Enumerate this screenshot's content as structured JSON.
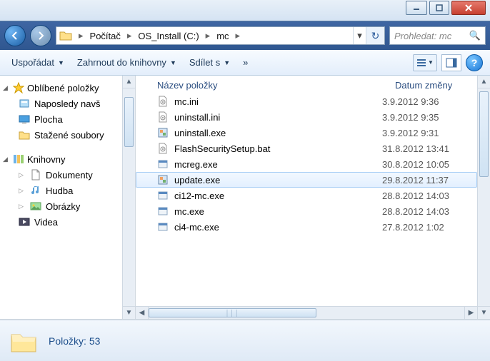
{
  "breadcrumbs": [
    "Počítač",
    "OS_Install (C:)",
    "mc"
  ],
  "search": {
    "placeholder": "Prohledat: mc"
  },
  "toolbar": {
    "organize": "Uspořádat",
    "include": "Zahrnout do knihovny",
    "share": "Sdílet s"
  },
  "tree": {
    "favorites": {
      "label": "Oblíbené položky",
      "items": [
        "Naposledy navš",
        "Plocha",
        "Stažené soubory"
      ]
    },
    "libraries": {
      "label": "Knihovny",
      "items": [
        "Dokumenty",
        "Hudba",
        "Obrázky",
        "Videa"
      ]
    }
  },
  "columns": {
    "name": "Název položky",
    "date": "Datum změny"
  },
  "files": [
    {
      "name": "mc.ini",
      "date": "3.9.2012 9:36",
      "icon": "ini"
    },
    {
      "name": "uninstall.ini",
      "date": "3.9.2012 9:35",
      "icon": "ini"
    },
    {
      "name": "uninstall.exe",
      "date": "3.9.2012 9:31",
      "icon": "exe"
    },
    {
      "name": "FlashSecuritySetup.bat",
      "date": "31.8.2012 13:41",
      "icon": "bat"
    },
    {
      "name": "mcreg.exe",
      "date": "30.8.2012 10:05",
      "icon": "app"
    },
    {
      "name": "update.exe",
      "date": "29.8.2012 11:37",
      "icon": "exe",
      "selected": true
    },
    {
      "name": "ci12-mc.exe",
      "date": "28.8.2012 14:03",
      "icon": "app"
    },
    {
      "name": "mc.exe",
      "date": "28.8.2012 14:03",
      "icon": "app"
    },
    {
      "name": "ci4-mc.exe",
      "date": "27.8.2012 1:02",
      "icon": "app"
    }
  ],
  "status": {
    "label": "Položky:",
    "count": "53"
  }
}
